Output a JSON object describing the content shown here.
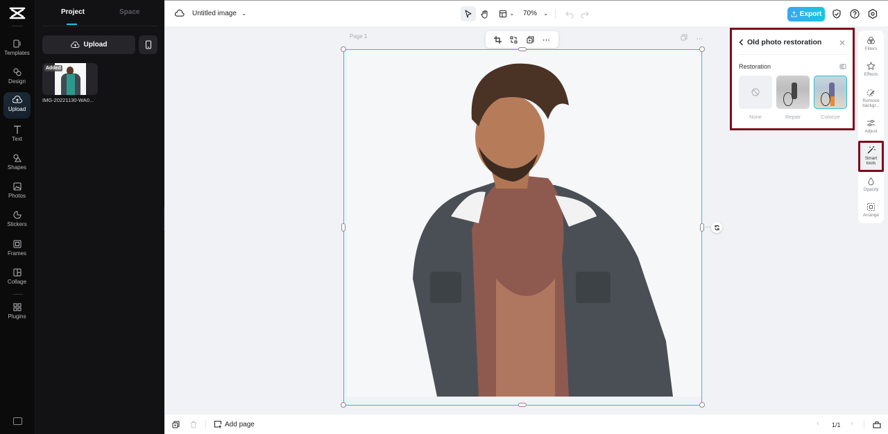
{
  "rail": {
    "items": [
      {
        "label": "Templates",
        "icon": "templates-icon"
      },
      {
        "label": "Design",
        "icon": "design-icon"
      },
      {
        "label": "Upload",
        "icon": "upload-cloud-icon",
        "active": true
      },
      {
        "label": "Text",
        "icon": "text-icon"
      },
      {
        "label": "Shapes",
        "icon": "shapes-icon"
      },
      {
        "label": "Photos",
        "icon": "photos-icon"
      },
      {
        "label": "Stickers",
        "icon": "stickers-icon"
      },
      {
        "label": "Frames",
        "icon": "frames-icon"
      },
      {
        "label": "Collage",
        "icon": "collage-icon"
      },
      {
        "label": "Plugins",
        "icon": "plugins-icon"
      }
    ]
  },
  "panel": {
    "tabs": [
      {
        "label": "Project",
        "active": true
      },
      {
        "label": "Space"
      }
    ],
    "upload_label": "Upload",
    "asset": {
      "badge": "Added",
      "name": "IMG-20221130-WA0..."
    }
  },
  "topbar": {
    "title": "Untitled image",
    "zoom": "70%",
    "export_label": "Export"
  },
  "canvas": {
    "page_label": "Page 1"
  },
  "bottombar": {
    "add_page_label": "Add page",
    "pager": "1/1"
  },
  "restoration_panel": {
    "title": "Old photo restoration",
    "section": "Restoration",
    "options": [
      {
        "label": "None"
      },
      {
        "label": "Repair"
      },
      {
        "label": "Colorize",
        "selected": true
      }
    ]
  },
  "tools": {
    "items": [
      {
        "label": "Filters"
      },
      {
        "label": "Effects"
      },
      {
        "label": "Remove backgr..."
      },
      {
        "label": "Adjust"
      },
      {
        "label": "Smart tools",
        "active": true
      },
      {
        "label": "Opacity"
      },
      {
        "label": "Arrange"
      }
    ]
  },
  "colors": {
    "accent": "#22c3da",
    "highlight_border": "#7d0b1c",
    "export_gradient_start": "#3aa6ef",
    "export_gradient_end": "#14c8e3"
  }
}
